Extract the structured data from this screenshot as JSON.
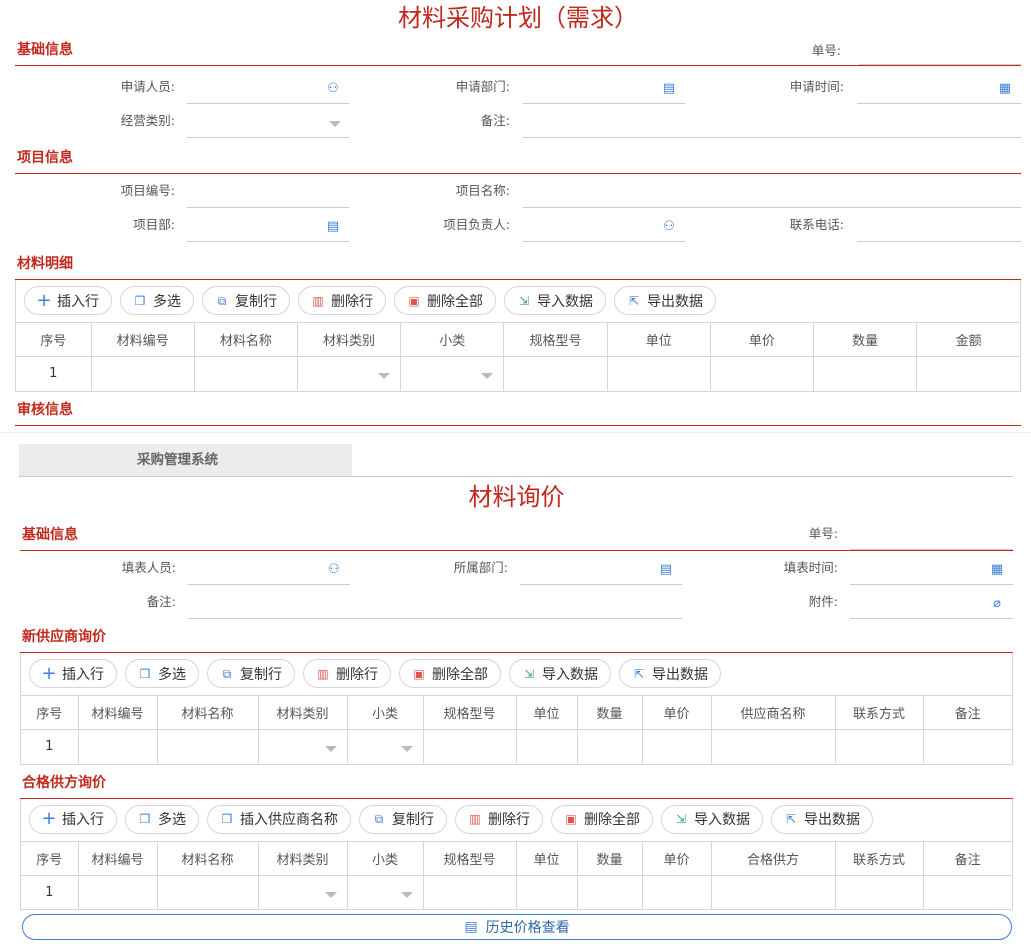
{
  "form1": {
    "title": "材料采购计划（需求）",
    "basic": {
      "title": "基础信息",
      "order_no_label": "单号:",
      "applicant_label": "申请人员:",
      "dept_label": "申请部门:",
      "time_label": "申请时间:",
      "biz_type_label": "经营类别:",
      "remark_label": "备注:"
    },
    "project": {
      "title": "项目信息",
      "no_label": "项目编号:",
      "name_label": "项目名称:",
      "dept_label": "项目部:",
      "manager_label": "项目负责人:",
      "phone_label": "联系电话:"
    },
    "detail": {
      "title": "材料明细",
      "buttons": [
        "插入行",
        "多选",
        "复制行",
        "删除行",
        "删除全部",
        "导入数据",
        "导出数据"
      ],
      "columns": [
        "序号",
        "材料编号",
        "材料名称",
        "材料类别",
        "小类",
        "规格型号",
        "单位",
        "单价",
        "数量",
        "金额"
      ],
      "row_no": "1"
    },
    "audit": {
      "title": "审核信息"
    }
  },
  "system_tab": "采购管理系统",
  "form2": {
    "title": "材料询价",
    "basic": {
      "title": "基础信息",
      "order_no_label": "单号:",
      "filler_label": "填表人员:",
      "dept_label": "所属部门:",
      "time_label": "填表时间:",
      "remark_label": "备注:",
      "attach_label": "附件:"
    },
    "new_supplier": {
      "title": "新供应商询价",
      "buttons": [
        "插入行",
        "多选",
        "复制行",
        "删除行",
        "删除全部",
        "导入数据",
        "导出数据"
      ],
      "columns": [
        "序号",
        "材料编号",
        "材料名称",
        "材料类别",
        "小类",
        "规格型号",
        "单位",
        "数量",
        "单价",
        "供应商名称",
        "联系方式",
        "备注"
      ],
      "row_no": "1"
    },
    "qualified": {
      "title": "合格供方询价",
      "buttons": [
        "插入行",
        "多选",
        "插入供应商名称",
        "复制行",
        "删除行",
        "删除全部",
        "导入数据",
        "导出数据"
      ],
      "columns": [
        "序号",
        "材料编号",
        "材料名称",
        "材料类别",
        "小类",
        "规格型号",
        "单位",
        "数量",
        "单价",
        "合格供方",
        "联系方式",
        "备注"
      ],
      "row_no": "1"
    },
    "history_button": "历史价格查看"
  },
  "icons": {
    "user": "user-icon",
    "org": "org-icon",
    "calendar": "calendar-icon",
    "attach": "paperclip-icon"
  },
  "colors": {
    "accent": "#c0291d",
    "link": "#3e7fd8"
  }
}
